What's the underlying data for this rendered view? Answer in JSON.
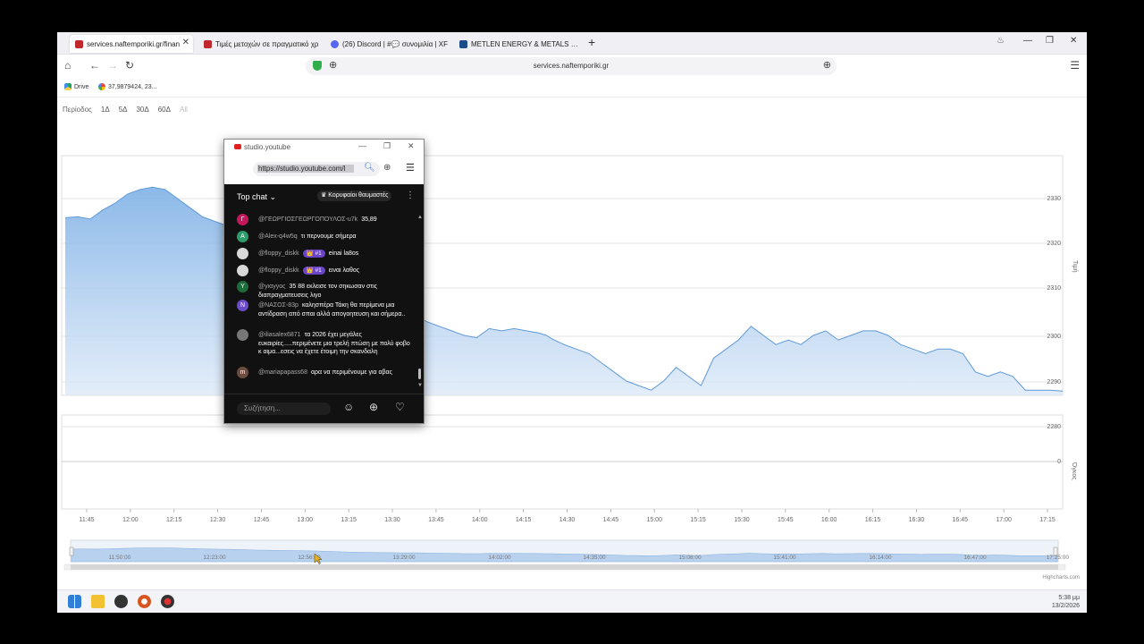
{
  "browser": {
    "tabs": [
      {
        "title": "services.naftemporiki.gr/finan",
        "color": "#c0282c",
        "active": true
      },
      {
        "title": "Τιμές μετοχών σε πραγματικό χρ",
        "color": "#c0282c",
        "active": false
      },
      {
        "title": "(26) Discord | #💬 συνομιλία | XF",
        "color": "#5865f2",
        "active": false
      },
      {
        "title": "METLEN ENERGY & METALS PLC (",
        "color": "#1c4f8a",
        "active": false
      }
    ],
    "url": "services.naftemporiki.gr",
    "bookmarks": [
      {
        "label": "Drive"
      },
      {
        "label": "37,9879424, 23..."
      }
    ]
  },
  "page": {
    "period_label": "Περίοδος",
    "period_buttons": [
      "1Δ",
      "5Δ",
      "30Δ",
      "60Δ",
      "All"
    ],
    "price_axis_title": "Τιμή",
    "volume_axis_title": "Όγκος",
    "credits": "Highcharts.com"
  },
  "chart_data": {
    "type": "area",
    "x_labels": [
      "11:45",
      "12:00",
      "12:15",
      "12:30",
      "12:45",
      "13:00",
      "13:15",
      "13:30",
      "13:45",
      "14:00",
      "14:15",
      "14:30",
      "14:45",
      "15:00",
      "15:15",
      "15:30",
      "15:45",
      "16:00",
      "16:15",
      "16:30",
      "16:45",
      "17:00",
      "17:15"
    ],
    "y_ticks": [
      2280,
      2290,
      2300,
      2310,
      2320,
      2330
    ],
    "ylim": [
      2280,
      2330
    ],
    "ylabel": "Τιμή",
    "volume_ticks": [
      0
    ],
    "volume_label": "Όγκος",
    "navigator_labels": [
      "11:50:00",
      "12:23:00",
      "12:56:00",
      "13:29:00",
      "14:02:00",
      "14:35:00",
      "15:08:00",
      "15:41:00",
      "16:14:00",
      "16:47:00",
      "17:25:00"
    ],
    "series": [
      {
        "values": [
          [
            0,
            2325.8
          ],
          [
            1,
            2326
          ],
          [
            2,
            2325.5
          ],
          [
            3,
            2327.5
          ],
          [
            4,
            2329
          ],
          [
            5,
            2331
          ],
          [
            6,
            2332
          ],
          [
            7,
            2332.5
          ],
          [
            8,
            2332
          ],
          [
            9,
            2330
          ],
          [
            10,
            2328
          ],
          [
            11,
            2326
          ],
          [
            12,
            2325
          ],
          [
            13,
            2324
          ],
          [
            14,
            2322
          ],
          [
            15,
            2320
          ],
          [
            16,
            2319
          ],
          [
            17,
            2318
          ],
          [
            18,
            2317
          ],
          [
            19,
            2316
          ],
          [
            20,
            2315
          ],
          [
            20.6,
            2313
          ],
          [
            21,
            2312
          ],
          [
            22,
            2310
          ],
          [
            23,
            2308
          ],
          [
            24,
            2307
          ],
          [
            25,
            2306
          ],
          [
            26,
            2305.5
          ],
          [
            27,
            2304
          ],
          [
            28,
            2304.5
          ],
          [
            29,
            2303
          ],
          [
            30,
            2302
          ],
          [
            31,
            2301
          ],
          [
            32,
            2300
          ],
          [
            33,
            2299.5
          ],
          [
            34,
            2301.5
          ],
          [
            35,
            2301
          ],
          [
            36,
            2301.5
          ],
          [
            37,
            2301
          ],
          [
            38,
            2300.5
          ],
          [
            38.6,
            2300
          ],
          [
            39,
            2299.3
          ],
          [
            40,
            2298
          ],
          [
            41,
            2297
          ],
          [
            42,
            2296
          ],
          [
            43,
            2294
          ],
          [
            44,
            2292
          ],
          [
            45,
            2290
          ],
          [
            46,
            2289
          ],
          [
            47,
            2288
          ],
          [
            48,
            2290
          ],
          [
            49,
            2293
          ],
          [
            50,
            2291
          ],
          [
            51,
            2289
          ],
          [
            52,
            2295
          ],
          [
            53,
            2297
          ],
          [
            54,
            2299
          ],
          [
            55,
            2302
          ],
          [
            56,
            2300
          ],
          [
            57,
            2298
          ],
          [
            58,
            2299
          ],
          [
            59,
            2298
          ],
          [
            60,
            2300
          ],
          [
            61,
            2301
          ],
          [
            62,
            2299
          ],
          [
            63,
            2300
          ],
          [
            64,
            2301
          ],
          [
            65,
            2301
          ],
          [
            66,
            2300
          ],
          [
            67,
            2298
          ],
          [
            68,
            2297
          ],
          [
            69,
            2296
          ],
          [
            70,
            2297
          ],
          [
            71,
            2297
          ],
          [
            72,
            2296
          ],
          [
            73,
            2292
          ],
          [
            74,
            2291
          ],
          [
            75,
            2292
          ],
          [
            76,
            2291
          ],
          [
            77,
            2288
          ],
          [
            78,
            2288
          ],
          [
            79,
            2288
          ],
          [
            80,
            2287.8
          ]
        ]
      }
    ]
  },
  "popup": {
    "title": "studio.youtube",
    "url": "https://studio.youtube.com/l",
    "chat_mode": "Top chat",
    "fans_button": "Κορυφαίοι θαυμαστές",
    "input_placeholder": "Συζήτηση...",
    "messages": [
      {
        "initial": "Γ",
        "color": "#c2185b",
        "user": "@ΓΕΩΡΓΙΟΣΓΕΩΡΓΟΠΟΥΛΟΣ-u7k",
        "badge": "",
        "text": "35,89"
      },
      {
        "initial": "A",
        "color": "#2e9c6a",
        "user": "@Alex-q4w5q",
        "badge": "",
        "text": "τι περνουμε σήμερα"
      },
      {
        "initial": "",
        "color": "#d8d8d8",
        "user": "@floppy_diskk",
        "badge": "👑 #1",
        "text": "einai la8os"
      },
      {
        "initial": "",
        "color": "#d8d8d8",
        "user": "@floppy_diskk",
        "badge": "👑 #1",
        "text": "ειναι λαθος"
      },
      {
        "initial": "Υ",
        "color": "#1e6b3b",
        "user": "@yιαyyος",
        "badge": "",
        "text": "35 88 εκλεισε τον σηκωσαν στις διαπραγματευσεις λιγο"
      },
      {
        "initial": "N",
        "color": "#6a4cc9",
        "user": "@ΝΑΣΟΣ-83p",
        "badge": "",
        "text": "καλησπέρα Τάκη θα περίμενα μια αντίδραση από σπαι αλλά απογοητευση και σήμερα.."
      },
      {
        "initial": "",
        "color": "#777",
        "user": "@iliasalex6871",
        "badge": "",
        "text": "τα 2026 έχει μεγάλες ευκαιρίες.....περιμένετε μια τρελή πτώση με πολύ φοβο κ αιμα...εσεις να έχετε έτοιμη την σκανδαλη"
      },
      {
        "initial": "m",
        "color": "#6d4c41",
        "user": "@mariapapass68",
        "badge": "",
        "text": "αρα να περιμένουμε για αβας"
      }
    ]
  },
  "system": {
    "time": "5:38 μμ",
    "date": "13/2/2026"
  }
}
